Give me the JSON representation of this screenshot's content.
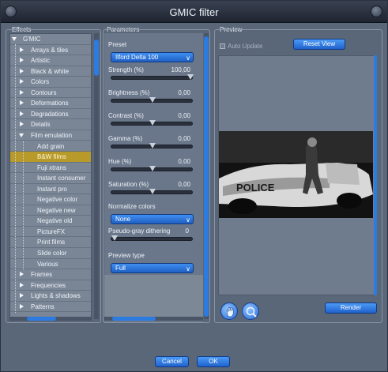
{
  "window": {
    "title": "GMIC filter"
  },
  "effects": {
    "title": "Effects",
    "items": [
      {
        "label": "G'MIC",
        "type": "root"
      },
      {
        "label": "Arrays & tiles",
        "type": "category"
      },
      {
        "label": "Artistic",
        "type": "category"
      },
      {
        "label": "Black & white",
        "type": "category"
      },
      {
        "label": "Colors",
        "type": "category"
      },
      {
        "label": "Contours",
        "type": "category"
      },
      {
        "label": "Deformations",
        "type": "category"
      },
      {
        "label": "Degradations",
        "type": "category"
      },
      {
        "label": "Details",
        "type": "category"
      },
      {
        "label": "Film emulation",
        "type": "open"
      },
      {
        "label": "Add grain",
        "type": "leaf"
      },
      {
        "label": "B&W films",
        "type": "leaf",
        "selected": true
      },
      {
        "label": "Fuji xtrans",
        "type": "leaf"
      },
      {
        "label": "Instant consumer",
        "type": "leaf"
      },
      {
        "label": "Instant pro",
        "type": "leaf"
      },
      {
        "label": "Negative color",
        "type": "leaf"
      },
      {
        "label": "Negative new",
        "type": "leaf"
      },
      {
        "label": "Negative old",
        "type": "leaf"
      },
      {
        "label": "PictureFX",
        "type": "leaf"
      },
      {
        "label": "Print films",
        "type": "leaf"
      },
      {
        "label": "Slide color",
        "type": "leaf"
      },
      {
        "label": "Various",
        "type": "leaf"
      },
      {
        "label": "Frames",
        "type": "category"
      },
      {
        "label": "Frequencies",
        "type": "category"
      },
      {
        "label": "Lights & shadows",
        "type": "category"
      },
      {
        "label": "Patterns",
        "type": "category"
      }
    ]
  },
  "parameters": {
    "title": "Parameters",
    "preset_label": "Preset",
    "preset_value": "Ilford Delta 100",
    "sliders": [
      {
        "label": "Strength (%)",
        "value": "100,00",
        "fraction": 1.0
      },
      {
        "label": "Brightness (%)",
        "value": "0,00",
        "fraction": 0.5
      },
      {
        "label": "Contrast (%)",
        "value": "0,00",
        "fraction": 0.5
      },
      {
        "label": "Gamma (%)",
        "value": "0,00",
        "fraction": 0.5
      },
      {
        "label": "Hue (%)",
        "value": "0,00",
        "fraction": 0.5
      },
      {
        "label": "Saturation (%)",
        "value": "0,00",
        "fraction": 0.5
      }
    ],
    "normalize_label": "Normalize colors",
    "normalize_value": "None",
    "pseudo_label": "Pseudo-gray dithering",
    "pseudo_value": "0",
    "pseudo_fraction": 0.0,
    "preview_type_label": "Preview type",
    "preview_type_value": "Full"
  },
  "preview": {
    "title": "Preview",
    "auto_update_label": "Auto Update",
    "reset_label": "Reset View",
    "render_label": "Render",
    "image_text": "POLICE"
  },
  "footer": {
    "cancel_label": "Cancel",
    "ok_label": "OK"
  },
  "colors": {
    "accent": "#2c7be0",
    "selected": "#b89a2a"
  },
  "icons": [
    "hand-icon",
    "zoom-icon",
    "chevron-down-icon",
    "expand-arrow-icon",
    "collapse-arrow-icon"
  ]
}
